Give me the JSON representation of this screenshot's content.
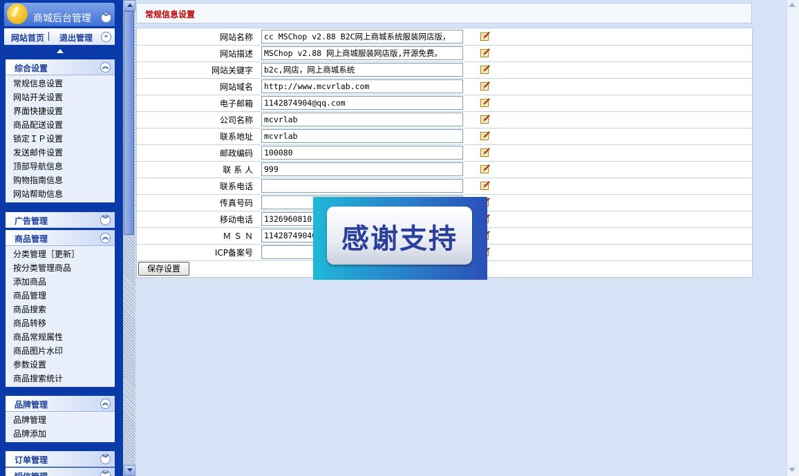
{
  "sidebar": {
    "app_title": "商城后台管理",
    "home_link": "网站首页",
    "logout_link": "退出管理",
    "sections": [
      {
        "title": "综合设置",
        "expanded": true,
        "items": [
          "常规信息设置",
          "网站开关设置",
          "界面快捷设置",
          "商品配送设置",
          "锁定ＩＰ设置",
          "发送邮件设置",
          "顶部导航信息",
          "购物指南信息",
          "网站帮助信息"
        ]
      },
      {
        "title": "广告管理",
        "expanded": false,
        "items": []
      },
      {
        "title": "商品管理",
        "expanded": true,
        "items": [
          "分类管理［更新］",
          "按分类管理商品",
          "添加商品",
          "商品管理",
          "商品搜索",
          "商品转移",
          "商品常规属性",
          "商品图片水印",
          "参数设置",
          "商品搜索统计"
        ]
      },
      {
        "title": "品牌管理",
        "expanded": true,
        "items": [
          "品牌管理",
          "品牌添加"
        ]
      },
      {
        "title": "订单管理",
        "expanded": false,
        "items": []
      },
      {
        "title": "短信管理",
        "expanded": false,
        "items": []
      }
    ]
  },
  "main": {
    "title": "常规信息设置",
    "fields": [
      {
        "label": "网站名称",
        "value": "cc MSChop v2.88 B2C网上商城系统服装网店版，"
      },
      {
        "label": "网站描述",
        "value": "MSChop v2.88  网上商城服装网店版,开源免费。"
      },
      {
        "label": "网站关键字",
        "value": "b2c,网店，网上商城系统"
      },
      {
        "label": "网站域名",
        "value": "http://www.mcvrlab.com"
      },
      {
        "label": "电子邮箱",
        "value": "1142874904@qq.com"
      },
      {
        "label": "公司名称",
        "value": "mcvrlab"
      },
      {
        "label": "联系地址",
        "value": "mcvrlab"
      },
      {
        "label": "邮政编码",
        "value": "100080"
      },
      {
        "label": "联 系 人",
        "value": "999"
      },
      {
        "label": "联系电话",
        "value": ""
      },
      {
        "label": "传真号码",
        "value": ""
      },
      {
        "label": "移动电话",
        "value": "1326960810"
      },
      {
        "label": "Ｍ Ｓ Ｎ",
        "value": "11428749040"
      },
      {
        "label": "ICP备案号",
        "value": ""
      }
    ],
    "save_label": "保存设置"
  },
  "overlay": {
    "text": "感谢支持"
  },
  "icons": {
    "edit": "edit-note-icon",
    "collapse": "chevron-up-icon",
    "expand": "chevron-down-icon"
  }
}
